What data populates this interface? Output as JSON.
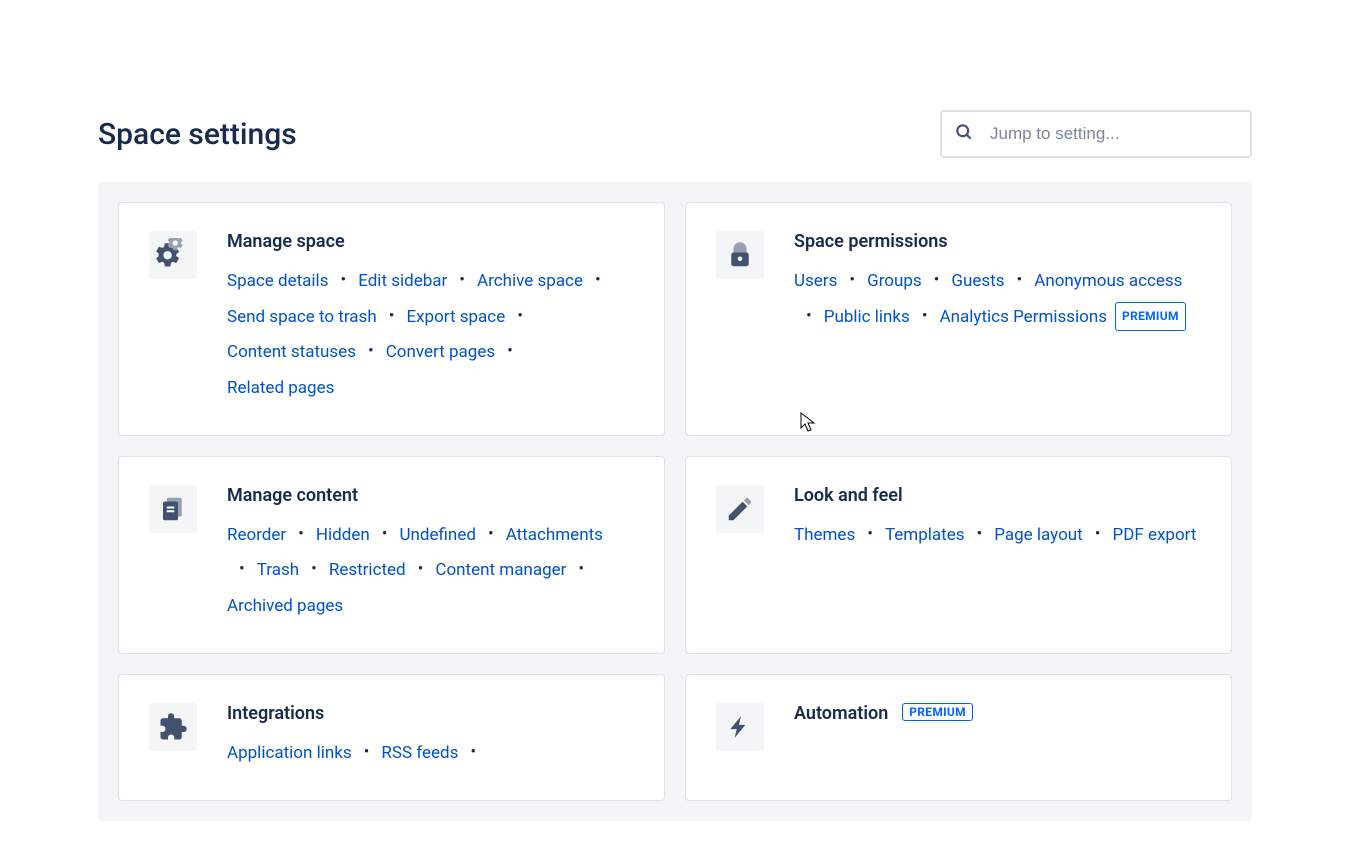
{
  "page_title": "Space settings",
  "search": {
    "placeholder": "Jump to setting..."
  },
  "badge_premium": "PREMIUM",
  "cards": {
    "manage_space": {
      "title": "Manage space",
      "links": [
        "Space details",
        "Edit sidebar",
        "Archive space",
        "Send space to trash",
        "Export space",
        "Content statuses",
        "Convert pages",
        "Related pages"
      ]
    },
    "space_permissions": {
      "title": "Space permissions",
      "links": [
        "Users",
        "Groups",
        "Guests",
        "Anonymous access",
        "Public links",
        "Analytics Permissions"
      ]
    },
    "manage_content": {
      "title": "Manage content",
      "links": [
        "Reorder",
        "Hidden",
        "Undefined",
        "Attachments",
        "Trash",
        "Restricted",
        "Content manager",
        "Archived pages"
      ]
    },
    "look_and_feel": {
      "title": "Look and feel",
      "links": [
        "Themes",
        "Templates",
        "Page layout",
        "PDF export"
      ]
    },
    "integrations": {
      "title": "Integrations",
      "links": [
        "Application links",
        "RSS feeds"
      ]
    },
    "automation": {
      "title": "Automation",
      "links": []
    }
  }
}
